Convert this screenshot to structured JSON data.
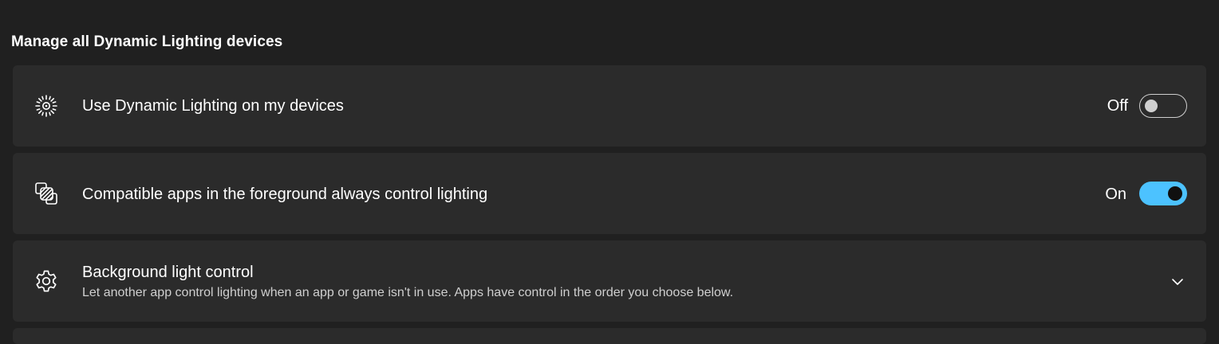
{
  "section": {
    "title": "Manage all Dynamic Lighting devices"
  },
  "settings": [
    {
      "icon": "dynamic-lighting-icon",
      "label": "Use Dynamic Lighting on my devices",
      "state_label": "Off",
      "toggle_on": false
    },
    {
      "icon": "apps-control-icon",
      "label": "Compatible apps in the foreground always control lighting",
      "state_label": "On",
      "toggle_on": true
    },
    {
      "icon": "gear-icon",
      "label": "Background light control",
      "description": "Let another app control lighting when an app or game isn't in use. Apps have control in the order you choose below.",
      "expander": "chevron-down-icon"
    }
  ],
  "colors": {
    "background": "#202020",
    "card": "#2b2b2b",
    "accent": "#4cc2ff"
  }
}
